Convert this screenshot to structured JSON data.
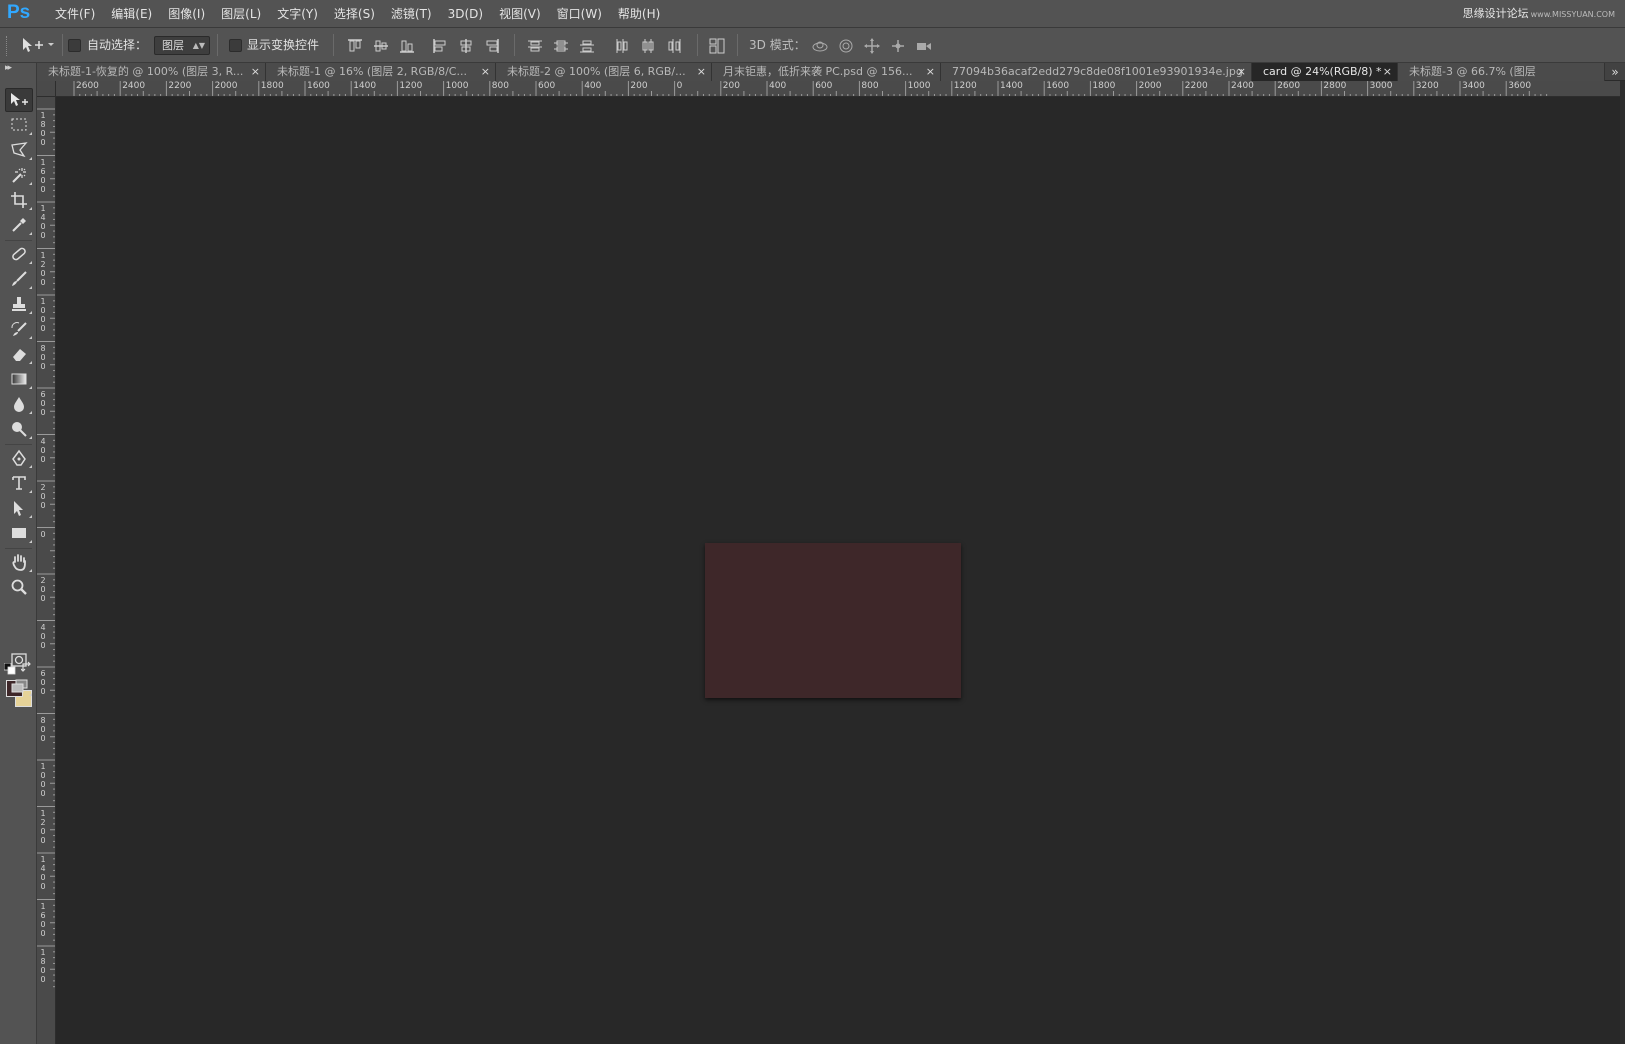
{
  "app": {
    "logo": "Ps"
  },
  "menu": [
    "文件(F)",
    "编辑(E)",
    "图像(I)",
    "图层(L)",
    "文字(Y)",
    "选择(S)",
    "滤镜(T)",
    "3D(D)",
    "视图(V)",
    "窗口(W)",
    "帮助(H)"
  ],
  "watermark": {
    "text": "思缘设计论坛",
    "site": "www.MISSYUAN.COM"
  },
  "options": {
    "auto_select_label": "自动选择：",
    "auto_select_target": "图层",
    "show_transform_label": "显示变换控件",
    "mode_3d_label": "3D 模式："
  },
  "tabs": [
    {
      "label": "未标题-1-恢复的 @ 100% (图层 3, R...",
      "active": false
    },
    {
      "label": "未标题-1 @ 16% (图层 2, RGB/8/C...",
      "active": false
    },
    {
      "label": "未标题-2 @ 100% (图层 6, RGB/...",
      "active": false
    },
    {
      "label": "月末钜惠，低折来袭 PC.psd @ 156...",
      "active": false
    },
    {
      "label": "77094b36acaf2edd279c8de08f1001e93901934e.jpg",
      "active": false
    },
    {
      "label": "card @ 24%(RGB/8) *",
      "active": true
    },
    {
      "label": "未标题-3 @ 66.7% (图层",
      "active": false
    }
  ],
  "tab_close_glyph": "×",
  "tab_overflow_glyph": "»",
  "ruler_top": [
    "2600",
    "2400",
    "2200",
    "2000",
    "1800",
    "1600",
    "1400",
    "1200",
    "1000",
    "800",
    "600",
    "400",
    "200",
    "0",
    "200",
    "400",
    "600",
    "800",
    "1000",
    "1200",
    "1400",
    "1600",
    "1800",
    "2000",
    "2200",
    "2400",
    "2600",
    "2800",
    "3000",
    "3200",
    "3400",
    "3600"
  ],
  "ruler_left": [
    "1800",
    "1600",
    "1400",
    "1200",
    "1000",
    "800",
    "600",
    "400",
    "200",
    "0",
    "200",
    "400",
    "600",
    "800",
    "1000",
    "1200",
    "1400",
    "1600",
    "1800"
  ],
  "colors": {
    "foreground": "#3e2729",
    "background": "#e6d398",
    "artboard": "#3e2729",
    "pasteboard": "#282828"
  },
  "tools": [
    "move-tool",
    "marquee-tool",
    "lasso-tool",
    "magic-wand-tool",
    "crop-tool",
    "eyedropper-tool",
    "healing-brush-tool",
    "brush-tool",
    "clone-stamp-tool",
    "history-brush-tool",
    "eraser-tool",
    "gradient-tool",
    "blur-tool",
    "dodge-tool",
    "pen-tool",
    "type-tool",
    "path-selection-tool",
    "rectangle-tool",
    "hand-tool",
    "zoom-tool"
  ]
}
